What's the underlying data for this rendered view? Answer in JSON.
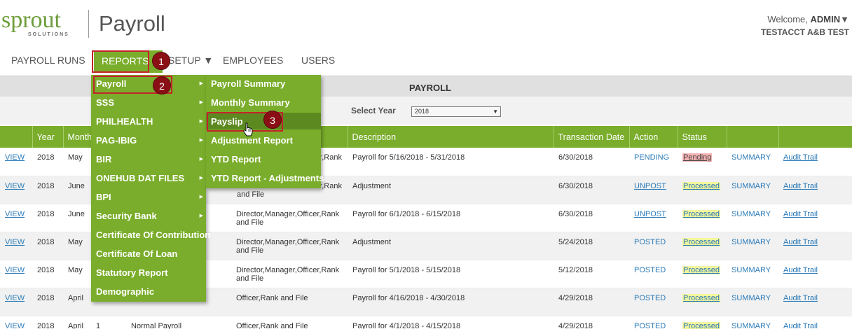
{
  "header": {
    "logo_text": "sprout",
    "logo_sub": "SOLUTIONS",
    "app_title": "Payroll",
    "welcome_prefix": "Welcome,",
    "user": "ADMIN",
    "user_caret": "▼",
    "account": "TESTACCT A&B TEST"
  },
  "nav": {
    "payroll_runs": "PAYROLL RUNS",
    "reports": "REPORTS ▼",
    "setup": "SETUP ▼",
    "employees": "EMPLOYEES",
    "users": "USERS"
  },
  "page": {
    "title": "PAYROLL",
    "year_label": "Select Year",
    "year_value": "2018",
    "year_caret": "▼"
  },
  "table": {
    "headers": [
      "",
      "Year",
      "Month",
      "",
      "",
      "",
      "Description",
      "Transaction Date",
      "Action",
      "Status",
      "",
      ""
    ],
    "rows": [
      {
        "view": "VIEW",
        "year": "2018",
        "month": "May",
        "cut": "",
        "type": "",
        "group": "Director,Manager,Officer,Rank and File",
        "group_visible": "fficer,Rank",
        "desc": "Payroll for 5/16/2018 - 5/31/2018",
        "date": "6/30/2018",
        "action": "PENDING",
        "status": "Pending",
        "summary": "SUMMARY",
        "audit": "Audit Trail"
      },
      {
        "view": "VIEW",
        "year": "2018",
        "month": "June",
        "cut": "",
        "type": "",
        "group": "Officer,Rank and File",
        "group_visible": "fficer,Rank",
        "group_visible2": "and File",
        "desc": "Adjustment",
        "date": "6/30/2018",
        "action": "UNPOST",
        "status": "Processed",
        "summary": "SUMMARY",
        "audit": "Audit Trail"
      },
      {
        "view": "VIEW",
        "year": "2018",
        "month": "June",
        "cut": "",
        "type": "",
        "group": "Director,Manager,Officer,Rank",
        "group2": "and File",
        "desc": "Payroll for 6/1/2018 - 6/15/2018",
        "date": "6/30/2018",
        "action": "UNPOST",
        "status": "Processed",
        "summary": "SUMMARY",
        "audit": "Audit Trail"
      },
      {
        "view": "VIEW",
        "year": "2018",
        "month": "May",
        "cut": "",
        "type": "",
        "group": "Director,Manager,Officer,Rank",
        "group2": "and File",
        "desc": "Adjustment",
        "date": "5/24/2018",
        "action": "POSTED",
        "status": "Processed",
        "summary": "SUMMARY",
        "audit": "Audit Trail"
      },
      {
        "view": "VIEW",
        "year": "2018",
        "month": "May",
        "cut": "",
        "type": "",
        "group": "Director,Manager,Officer,Rank",
        "group2": "and File",
        "desc": "Payroll for 5/1/2018 - 5/15/2018",
        "date": "5/12/2018",
        "action": "POSTED",
        "status": "Processed",
        "summary": "SUMMARY",
        "audit": "Audit Trail"
      },
      {
        "view": "VIEW",
        "year": "2018",
        "month": "April",
        "cut": "",
        "type": "",
        "group": "Officer,Rank and File",
        "group2": "",
        "desc": "Payroll for 4/16/2018 - 4/30/2018",
        "date": "4/29/2018",
        "action": "POSTED",
        "status": "Processed",
        "summary": "SUMMARY",
        "audit": "Audit Trail"
      },
      {
        "view": "VIEW",
        "year": "2018",
        "month": "April",
        "cut": "1",
        "type": "Normal Payroll",
        "group": "Officer,Rank and File",
        "group2": "",
        "desc": "Payroll for 4/1/2018 - 4/15/2018",
        "date": "4/29/2018",
        "action": "POSTED",
        "status": "Processed",
        "summary": "SUMMARY",
        "audit": "Audit Trail"
      }
    ]
  },
  "menu_reports": {
    "items": [
      "Payroll",
      "SSS",
      "PHILHEALTH",
      "PAG-IBIG",
      "BIR",
      "ONEHUB DAT FILES",
      "BPI",
      "Security Bank",
      "Certificate Of Contribution",
      "Certificate Of Loan",
      "Statutory Report",
      "Demographic"
    ],
    "arrow": "▶"
  },
  "menu_payroll": {
    "items": [
      "Payroll Summary",
      "Monthly Summary",
      "Payslip",
      "Adjustment Report",
      "YTD Report",
      "YTD Report - Adjustments"
    ]
  },
  "callouts": [
    "1",
    "2",
    "3"
  ],
  "colors": {
    "green": "#7aad2b",
    "green_dark": "#5d8a20",
    "callout": "#c4232a",
    "link": "#2a7ab8"
  },
  "icons": {
    "cursor": "hand-pointer-icon",
    "submenu": "triangle-right-icon"
  }
}
